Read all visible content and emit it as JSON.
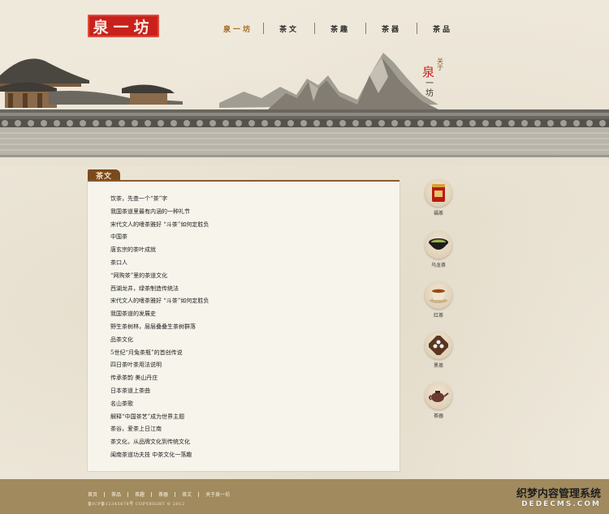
{
  "logo": {
    "text": "泉一坊"
  },
  "nav": [
    {
      "label": "泉一坊",
      "active": true
    },
    {
      "label": "茶文",
      "active": false
    },
    {
      "label": "茶趣",
      "active": false
    },
    {
      "label": "茶器",
      "active": false
    },
    {
      "label": "茶品",
      "active": false
    }
  ],
  "about": {
    "small": "关于",
    "big": "泉",
    "sub": "一坊"
  },
  "section": {
    "tab": "茶文"
  },
  "articles": [
    "饮茶，先查一个“茶”字",
    "我国茶道里最有内涵的一种礼节",
    "宋代文人的嗜茶雅好 “斗茶”如何定胜负",
    "中国茶",
    "唐玄宗的茶叶成就",
    "茶口人",
    "“网购茶”里的茶道文化",
    "西湖龙井，绿茶制造传统法",
    "宋代文人的嗜茶雅好 “斗茶”如何定胜负",
    "我国茶道的发展史",
    "野生茶树林，层层叠叠生茶树群落",
    "品茶文化",
    "5世纪“月兔茶瓶”的首创传说",
    "四日茶叶茶用法说明",
    "传承茶韵 美山丹庄",
    "日本茶道上茶曲",
    "名山茶歌",
    "解释“中国茶艺”成为世界主题",
    "茶谷，爱茶上日江南",
    "茶文化，从品牌文化到传统文化",
    "闽南茶道功夫技 中茶文化一落趣"
  ],
  "categories": [
    {
      "label": "福茶",
      "icon": "tea-tin-icon"
    },
    {
      "label": "乌龙茶",
      "icon": "tea-bowl-icon"
    },
    {
      "label": "红茶",
      "icon": "tea-cup-icon"
    },
    {
      "label": "黑茶",
      "icon": "tea-tray-icon"
    },
    {
      "label": "茶器",
      "icon": "teapot-icon"
    }
  ],
  "footer": {
    "links": [
      "首页",
      "茶品",
      "茶趣",
      "茶器",
      "茶文",
      "关于泉一坊"
    ],
    "copyright": "备ICP备12345678号 COPYRIGHT © 2012"
  },
  "watermark": {
    "line1": "织梦内容管理系统",
    "line2": "DEDECMS.COM"
  },
  "colors": {
    "accent": "#a8671d",
    "seal": "#c8211b",
    "footer": "#a08a5e",
    "tab": "#7a4a1c"
  }
}
